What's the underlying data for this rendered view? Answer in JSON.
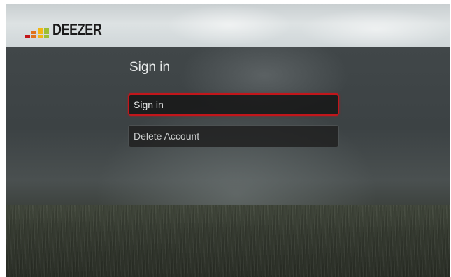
{
  "brand": {
    "name": "DEEZER",
    "logo_colors": [
      "#c2161b",
      "#e0731c",
      "#f2b613",
      "#9dbf33",
      "#3c9bd1"
    ]
  },
  "sign_in_screen": {
    "title": "Sign in",
    "menu": [
      {
        "label": "Sign in",
        "selected": true
      },
      {
        "label": "Delete Account",
        "selected": false
      }
    ]
  },
  "colors": {
    "selection_border": "#c2161b"
  }
}
